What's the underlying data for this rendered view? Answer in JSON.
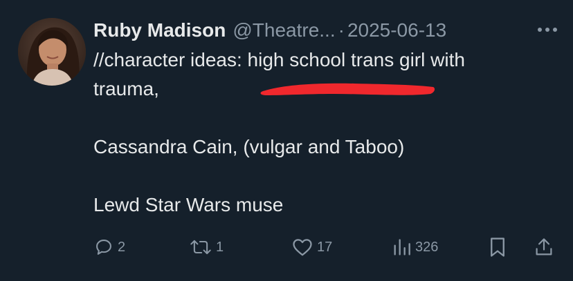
{
  "tweet": {
    "display_name": "Ruby Madison",
    "handle": "@Theatre...",
    "separator": "·",
    "date": "2025-06-13",
    "lines": [
      "//character ideas: high school trans girl with",
      "trauma,",
      "",
      "Cassandra Cain, (vulgar and Taboo)",
      "",
      "Lewd Star Wars muse"
    ],
    "stats": {
      "replies": "2",
      "reposts": "1",
      "likes": "17",
      "views": "326"
    }
  },
  "icons": {
    "more": "more-dots-icon",
    "reply": "reply-icon",
    "repost": "repost-icon",
    "like": "heart-icon",
    "views": "views-icon",
    "bookmark": "bookmark-icon",
    "share": "share-icon"
  },
  "colors": {
    "background": "#15202b",
    "text": "#e7e9ea",
    "muted": "#8b98a5",
    "annotation_mark": "#f0282d"
  }
}
